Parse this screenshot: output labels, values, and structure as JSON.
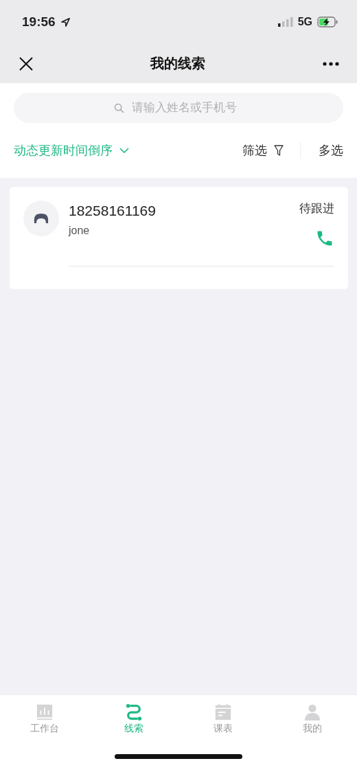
{
  "status_bar": {
    "time": "19:56",
    "network": "5G"
  },
  "nav_bar": {
    "title": "我的线索"
  },
  "search": {
    "placeholder": "请输入姓名或手机号"
  },
  "toolbar": {
    "sort": "动态更新时间倒序",
    "filter": "筛选",
    "multi_select": "多选"
  },
  "leads": [
    {
      "phone": "18258161169",
      "name": "jone",
      "status": "待跟进"
    }
  ],
  "tab_bar": [
    {
      "label": "工作台",
      "kind": "dashboard",
      "selected": false
    },
    {
      "label": "线索",
      "kind": "route",
      "selected": true
    },
    {
      "label": "课表",
      "kind": "calendar",
      "selected": false
    },
    {
      "label": "我的",
      "kind": "person",
      "selected": false
    }
  ]
}
